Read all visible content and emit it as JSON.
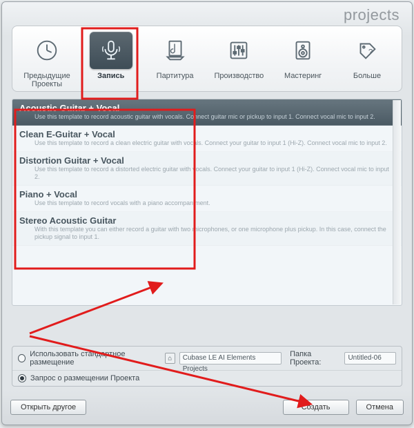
{
  "brand": "projects",
  "tabs": [
    {
      "key": "prev",
      "label": "Предыдущие Проекты"
    },
    {
      "key": "record",
      "label": "Запись"
    },
    {
      "key": "score",
      "label": "Партитура"
    },
    {
      "key": "prod",
      "label": "Производство"
    },
    {
      "key": "master",
      "label": "Мастеринг"
    },
    {
      "key": "more",
      "label": "Больше"
    }
  ],
  "active_tab": 1,
  "templates": [
    {
      "title": "Acoustic Guitar + Vocal",
      "desc": "Use this template to record acoustic guitar with vocals. Connect guitar mic or pickup to input  1. Connect vocal mic to input 2.",
      "selected": true
    },
    {
      "title": "Clean E-Guitar + Vocal",
      "desc": "Use this template to record a clean electric guitar with vocals. Connect your guitar to input  1 (Hi-Z). Connect vocal mic to input 2."
    },
    {
      "title": "Distortion Guitar + Vocal",
      "desc": "Use this template to record a distorted electric guitar with vocals. Connect your guitar to input  1 (Hi-Z). Connect vocal mic to input 2."
    },
    {
      "title": "Piano + Vocal",
      "desc": "Use this template to record vocals with a piano accompaniment."
    },
    {
      "title": "Stereo Acoustic Guitar",
      "desc": "With this template you can either record a guitar with two microphones, or one microphone plus pickup. In this case, connect the pickup signal to input 1."
    }
  ],
  "options": {
    "use_default_label": "Использовать стандартное размещение",
    "default_path": "Cubase LE AI Elements Projects",
    "folder_label": "Папка Проекта:",
    "folder_value": "Untitled-06",
    "ask_location_label": "Запрос о размещении Проекта",
    "selected_option": "ask"
  },
  "buttons": {
    "open_other": "Открыть другое",
    "create": "Создать",
    "cancel": "Отмена"
  },
  "colors": {
    "annotation": "#e11c1c"
  }
}
